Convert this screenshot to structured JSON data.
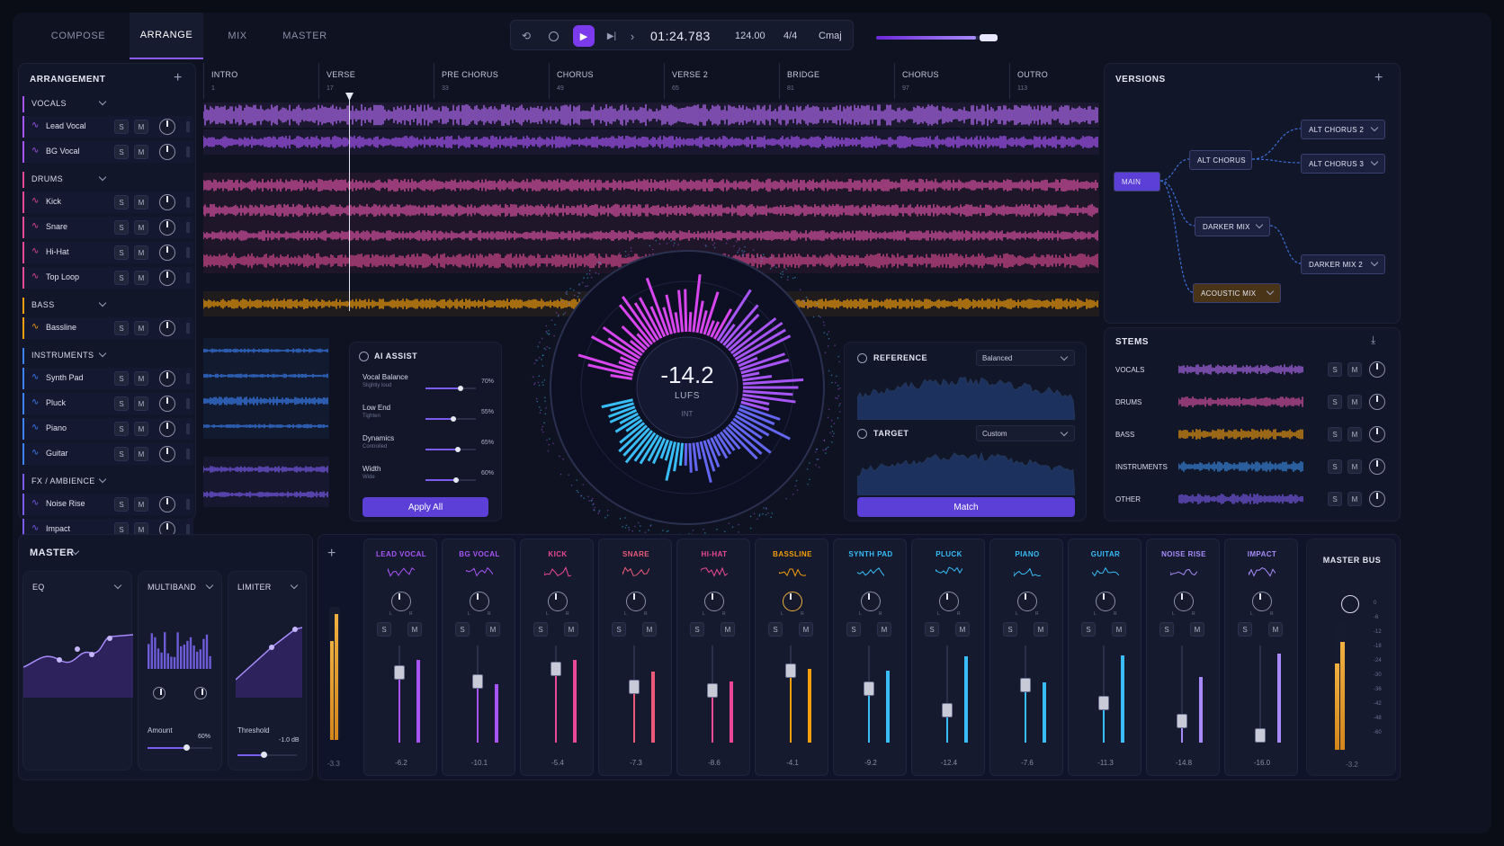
{
  "tabs": [
    "COMPOSE",
    "ARRANGE",
    "MIX",
    "MASTER"
  ],
  "transport": {
    "time": "01:24.783",
    "bpm": "124.00",
    "meter": "4/4",
    "key": "Cmaj",
    "progress": 0.82
  },
  "arrangement": {
    "title": "ARRANGEMENT",
    "groups": [
      {
        "name": "VOCALS",
        "color": "#a855f7",
        "tracks": [
          {
            "name": "Lead Vocal"
          },
          {
            "name": "BG Vocal"
          }
        ]
      },
      {
        "name": "DRUMS",
        "color": "#ec4899",
        "tracks": [
          {
            "name": "Kick"
          },
          {
            "name": "Snare"
          },
          {
            "name": "Hi-Hat"
          },
          {
            "name": "Top Loop"
          }
        ]
      },
      {
        "name": "BASS",
        "color": "#f59e0b",
        "tracks": [
          {
            "name": "Bassline"
          }
        ]
      },
      {
        "name": "INSTRUMENTS",
        "color": "#3b82f6",
        "tracks": [
          {
            "name": "Synth Pad"
          },
          {
            "name": "Pluck"
          },
          {
            "name": "Piano"
          },
          {
            "name": "Guitar"
          }
        ]
      },
      {
        "name": "FX / AMBIENCE",
        "color": "#7c5cf0",
        "tracks": [
          {
            "name": "Noise Rise"
          },
          {
            "name": "Impact"
          }
        ]
      }
    ]
  },
  "sections": [
    {
      "name": "INTRO",
      "bar": "1"
    },
    {
      "name": "VERSE",
      "bar": "17"
    },
    {
      "name": "PRE CHORUS",
      "bar": "33"
    },
    {
      "name": "CHORUS",
      "bar": "49"
    },
    {
      "name": "VERSE 2",
      "bar": "65"
    },
    {
      "name": "BRIDGE",
      "bar": "81"
    },
    {
      "name": "CHORUS",
      "bar": "97"
    },
    {
      "name": "OUTRO",
      "bar": "113"
    }
  ],
  "ai": {
    "title": "AI ASSIST",
    "apply": "Apply All",
    "params": [
      {
        "name": "Vocal Balance",
        "sub": "Slightly loud",
        "value": "70%",
        "level": 0.7
      },
      {
        "name": "Low End",
        "sub": "Tighten",
        "value": "55%",
        "level": 0.55
      },
      {
        "name": "Dynamics",
        "sub": "Controlled",
        "value": "65%",
        "level": 0.65
      },
      {
        "name": "Width",
        "sub": "Wide",
        "value": "60%",
        "level": 0.6
      }
    ]
  },
  "meter": {
    "value": "-14.2",
    "unit": "LUFS",
    "mode": "INT"
  },
  "reference": {
    "title": "REFERENCE",
    "preset": "Balanced",
    "target_title": "TARGET",
    "target_preset": "Custom",
    "match": "Match"
  },
  "versions": {
    "title": "VERSIONS",
    "nodes": [
      "MAIN",
      "ALT CHORUS",
      "ALT CHORUS 2",
      "ALT CHORUS 3",
      "DARKER MIX",
      "DARKER MIX 2",
      "ACOUSTIC MIX"
    ]
  },
  "stems": {
    "title": "STEMS",
    "items": [
      {
        "name": "VOCALS",
        "color": "#b46cf5"
      },
      {
        "name": "DRUMS",
        "color": "#e052a8"
      },
      {
        "name": "BASS",
        "color": "#f59e0b"
      },
      {
        "name": "INSTRUMENTS",
        "color": "#3b8fe8"
      },
      {
        "name": "OTHER",
        "color": "#7c5cf0"
      }
    ]
  },
  "master": {
    "title": "MASTER",
    "eq": "EQ",
    "multiband": "MULTIBAND",
    "limiter": "LIMITER",
    "amount_label": "Amount",
    "amount": "60%",
    "threshold_label": "Threshold",
    "threshold": "-1.0 dB",
    "meter_val": "-3.3"
  },
  "channels": [
    {
      "name": "LEAD VOCAL",
      "color": "#a855f7",
      "db": "-6.2"
    },
    {
      "name": "BG VOCAL",
      "color": "#a855f7",
      "db": "-10.1"
    },
    {
      "name": "KICK",
      "color": "#ec4899",
      "db": "-5.4"
    },
    {
      "name": "SNARE",
      "color": "#ec5a7a",
      "db": "-7.3"
    },
    {
      "name": "HI-HAT",
      "color": "#ec4899",
      "db": "-8.6"
    },
    {
      "name": "BASSLINE",
      "color": "#f59e0b",
      "db": "-4.1"
    },
    {
      "name": "SYNTH PAD",
      "color": "#38bdf8",
      "db": "-9.2"
    },
    {
      "name": "PLUCK",
      "color": "#38bdf8",
      "db": "-12.4"
    },
    {
      "name": "PIANO",
      "color": "#38bdf8",
      "db": "-7.6"
    },
    {
      "name": "GUITAR",
      "color": "#38bdf8",
      "db": "-11.3"
    },
    {
      "name": "NOISE RISE",
      "color": "#a78bfa",
      "db": "-14.8"
    },
    {
      "name": "IMPACT",
      "color": "#a78bfa",
      "db": "-16.0"
    }
  ],
  "master_bus": {
    "title": "MASTER BUS",
    "db": "-3.2",
    "scale": [
      "0",
      "-6",
      "-12",
      "-18",
      "-24",
      "-30",
      "-36",
      "-42",
      "-48",
      "-60"
    ]
  },
  "sm": {
    "s": "S",
    "m": "M",
    "l": "L",
    "r": "R"
  }
}
